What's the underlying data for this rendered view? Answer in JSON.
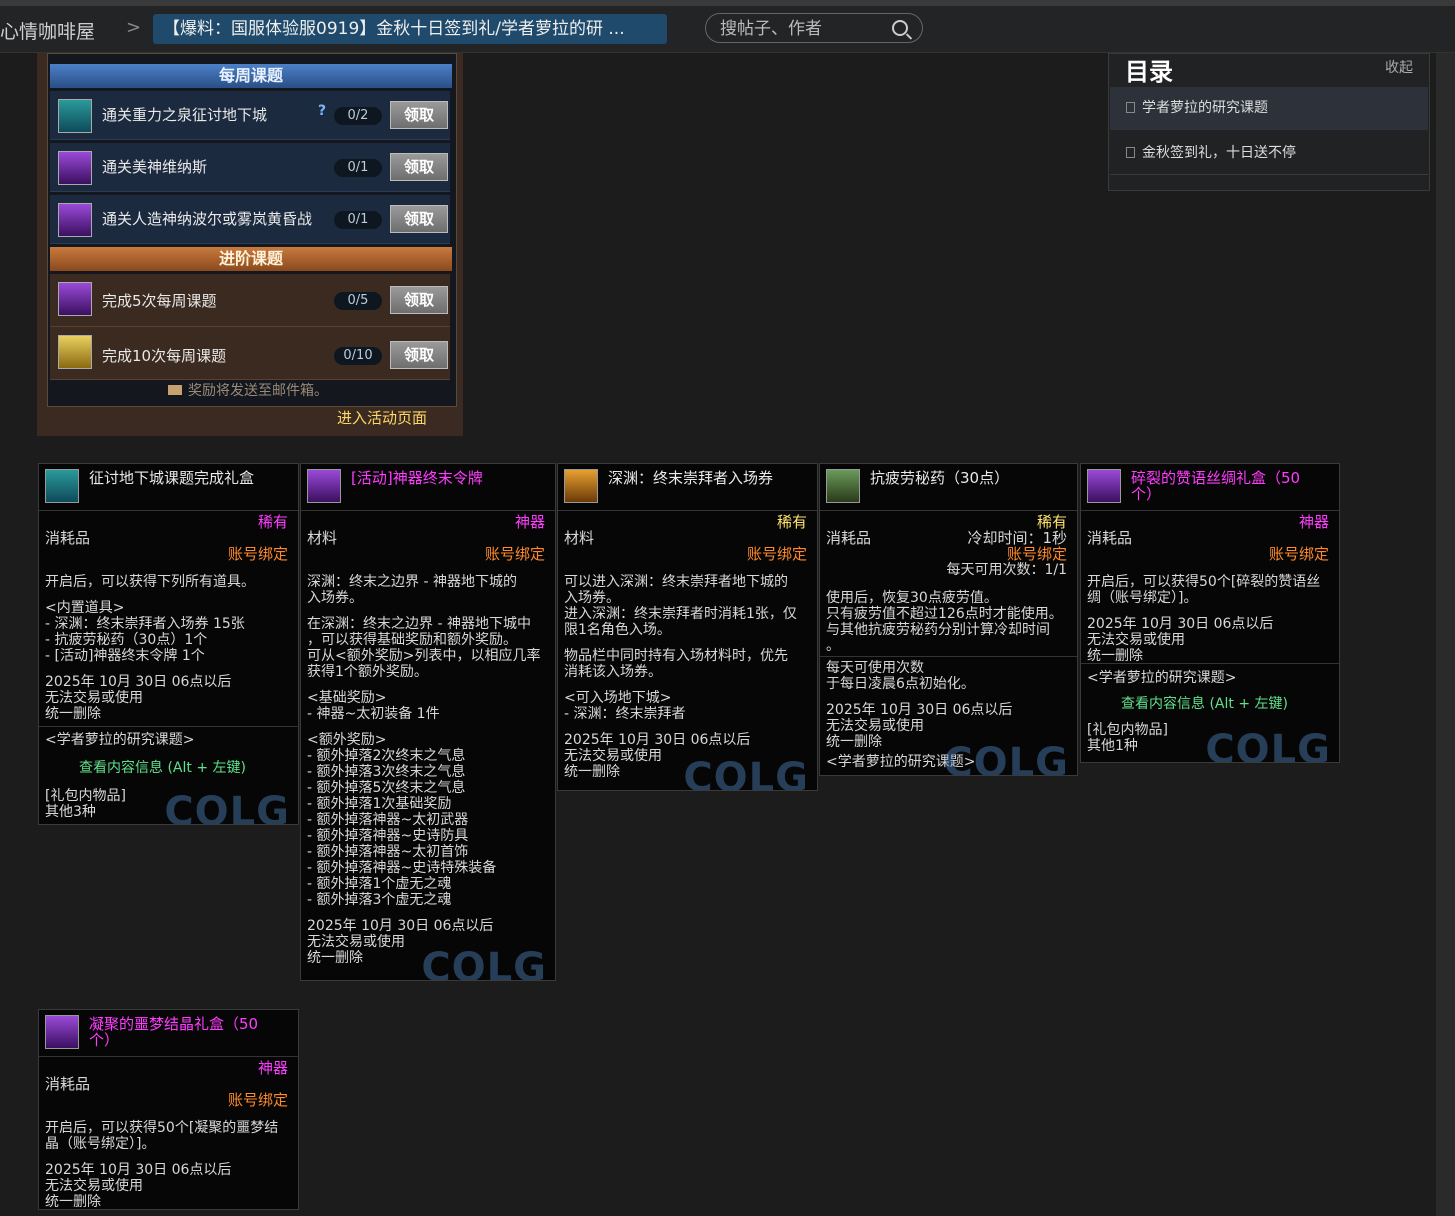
{
  "topbar": {
    "site": "心情咖啡屋",
    "sep": ">",
    "thread_title": "【爆料：国服体验服0919】金秋十日签到礼/学者萝拉的研 ...",
    "search_placeholder": "搜帖子、作者"
  },
  "toc": {
    "title": "目录",
    "collapse": "收起",
    "items": [
      "学者萝拉的研究课题",
      "金秋签到礼，十日送不停"
    ]
  },
  "game": {
    "weekly_header": "每周课题",
    "advanced_header": "进阶课题",
    "claim": "领取",
    "weekly": [
      {
        "label": "通关重力之泉征讨地下城",
        "progress": "0/2",
        "hint": "?"
      },
      {
        "label": "通关美神维纳斯",
        "progress": "0/1"
      },
      {
        "label": "通关人造神纳波尔或雾岚黄昏战",
        "progress": "0/1"
      }
    ],
    "advanced": [
      {
        "label": "完成5次每周课题",
        "progress": "0/5"
      },
      {
        "label": "完成10次每周课题",
        "progress": "0/10"
      }
    ],
    "mail_note": "奖励将发送至邮件箱。",
    "enter": "进入活动页面"
  },
  "cards": [
    {
      "name": "征讨地下城课题完成礼盒",
      "rarity": "稀有",
      "type": "消耗品",
      "bind": "账号绑定",
      "b1": "开启后，可以获得下列所有道具。",
      "b2": "<内置道具>\n- 深渊：终末崇拜者入场券 15张\n- 抗疲劳秘药（30点）1个\n- [活动]神器终末令牌 1个",
      "b3": "2025年 10月 30日 06点以后\n无法交易或使用\n统一删除",
      "b4": "<学者萝拉的研究课题>",
      "green": "查看内容信息 (Alt + 左键)",
      "b5": "[礼包内物品]\n其他3种"
    },
    {
      "name": "[活动]神器终末令牌",
      "rarity": "神器",
      "type": "材料",
      "bind": "账号绑定",
      "b1": "深渊：终末之边界 - 神器地下城的\n入场券。",
      "b2": "在深渊：终末之边界 - 神器地下城中\n，可以获得基础奖励和额外奖励。\n可从<额外奖励>列表中，以相应几率\n获得1个额外奖励。",
      "b3": "<基础奖励>\n- 神器~太初装备 1件",
      "b4": "<额外奖励>\n- 额外掉落2次终末之气息\n- 额外掉落3次终末之气息\n- 额外掉落5次终末之气息\n- 额外掉落1次基础奖励\n- 额外掉落神器~太初武器\n- 额外掉落神器~史诗防具\n- 额外掉落神器~太初首饰\n- 额外掉落神器~史诗特殊装备\n- 额外掉落1个虚无之魂\n- 额外掉落3个虚无之魂",
      "b5": "2025年 10月 30日 06点以后\n无法交易或使用\n统一删除"
    },
    {
      "name": "深渊：终末崇拜者入场券",
      "rarity": "稀有",
      "type": "材料",
      "bind": "账号绑定",
      "b1": "可以进入深渊：终末崇拜者地下城的\n入场券。\n进入深渊：终末崇拜者时消耗1张，仅\n限1名角色入场。",
      "b2": "物品栏中同时持有入场材料时，优先\n消耗该入场券。",
      "b3": "<可入场地下城>\n- 深渊：终末崇拜者",
      "b4": "2025年 10月 30日 06点以后\n无法交易或使用\n统一删除"
    },
    {
      "name": "抗疲劳秘药（30点）",
      "rarity": "稀有",
      "type": "消耗品",
      "bind": "账号绑定",
      "cooldown": "冷却时间：1秒",
      "daily": "每天可用次数：1/1",
      "b1": "使用后，恢复30点疲劳值。\n只有疲劳值不超过126点时才能使用。\n与其他抗疲劳秘药分别计算冷却时间\n。",
      "b2": "每天可使用次数\n于每日凌晨6点初始化。",
      "b3": "2025年 10月 30日 06点以后\n无法交易或使用\n统一删除",
      "b4": "<学者萝拉的研究课题>"
    },
    {
      "name": "碎裂的赞语丝绸礼盒（50\n个）",
      "rarity": "神器",
      "type": "消耗品",
      "bind": "账号绑定",
      "b1": "开启后，可以获得50个[碎裂的赞语丝\n绸（账号绑定）]。",
      "b2": "2025年 10月 30日 06点以后\n无法交易或使用\n统一删除",
      "b3": "<学者萝拉的研究课题>",
      "green": "查看内容信息 (Alt + 左键)",
      "b4": "[礼包内物品]\n其他1种"
    },
    {
      "name": "凝聚的噩梦结晶礼盒（50\n个）",
      "rarity": "神器",
      "type": "消耗品",
      "bind": "账号绑定",
      "b1": "开启后，可以获得50个[凝聚的噩梦结\n晶（账号绑定）]。",
      "b2": "2025年 10月 30日 06点以后\n无法交易或使用\n统一删除"
    }
  ],
  "watermark": "COLG",
  "colors": {
    "accent": "#1f4a6b",
    "legendary": "#ff3cff",
    "rare": "#ffe26a",
    "bind": "#ff8a2a",
    "hint": "#5fe08a"
  }
}
